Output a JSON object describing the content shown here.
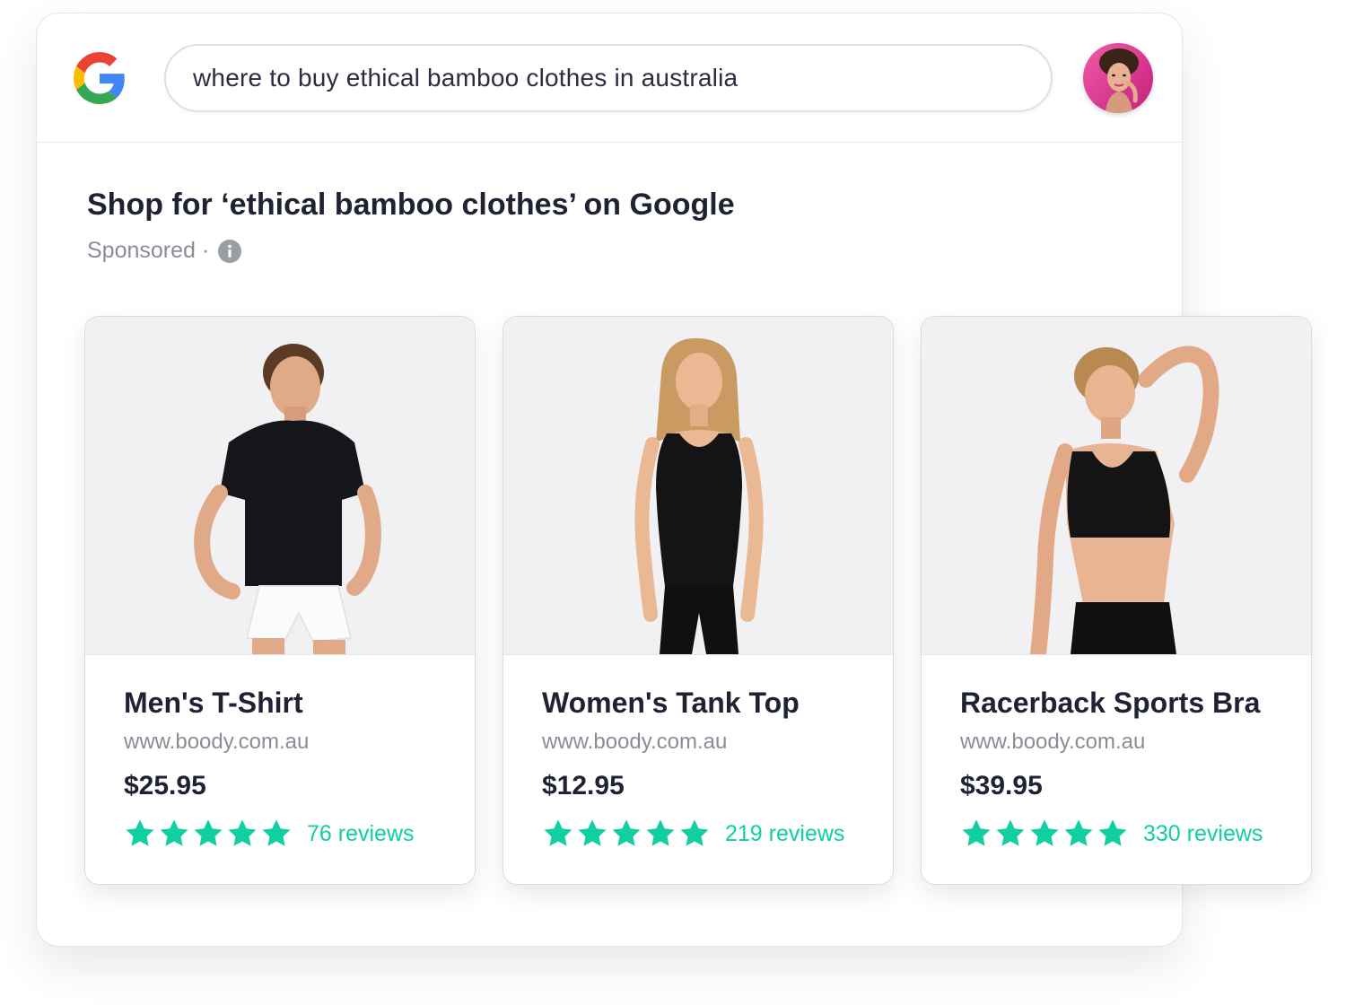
{
  "search": {
    "query": "where to buy ethical bamboo clothes in australia"
  },
  "section": {
    "title": "Shop for ‘ethical bamboo clothes’ on Google",
    "sponsored_label": "Sponsored ·"
  },
  "products": [
    {
      "name": "Men's T-Shirt",
      "url": "www.boody.com.au",
      "price": "$25.95",
      "rating": 5,
      "reviews": "76 reviews"
    },
    {
      "name": "Women's Tank Top",
      "url": "www.boody.com.au",
      "price": "$12.95",
      "rating": 5,
      "reviews": "219 reviews"
    },
    {
      "name": "Racerback Sports Bra",
      "url": "www.boody.com.au",
      "price": "$39.95",
      "rating": 5,
      "reviews": "330 reviews"
    }
  ],
  "icons": {
    "logo": "google-g-icon",
    "avatar": "user-avatar",
    "info": "info-icon",
    "star": "star-icon"
  },
  "colors": {
    "star": "#10cfa0",
    "reviews": "#10cfa0",
    "text": "#1f2232",
    "muted": "#8a8d96"
  }
}
